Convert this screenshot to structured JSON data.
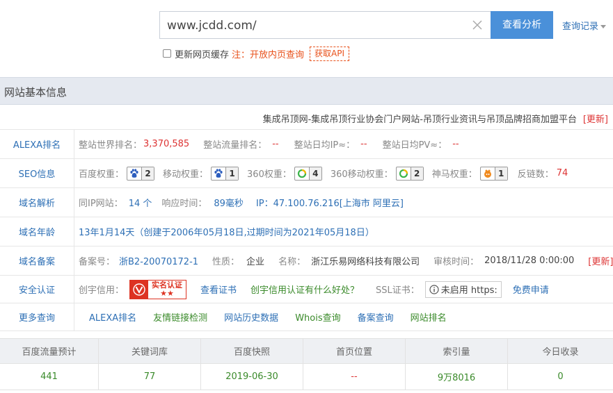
{
  "search": {
    "value": "www.jcdd.com/",
    "button_label": "查看分析",
    "history_label": "查询记录"
  },
  "options": {
    "cache_label": "更新网页缓存",
    "note": "注：开放内页查询",
    "api_label": "获取API"
  },
  "section": {
    "title": "网站基本信息",
    "site_title": "集成吊顶网-集成吊顶行业协会门户网站-吊顶行业资讯与吊顶品牌招商加盟平台",
    "update_label": "[更新]"
  },
  "alexa": {
    "label": "ALEXA排名",
    "world_rank_key": "整站世界排名：",
    "world_rank": "3,370,585",
    "traffic_rank_key": "整站流量排名：",
    "traffic_rank": "--",
    "daily_ip_key": "整站日均IP≈：",
    "daily_ip": "--",
    "daily_pv_key": "整站日均PV≈：",
    "daily_pv": "--"
  },
  "seo": {
    "label": "SEO信息",
    "baidu_key": "百度权重：",
    "baidu": "2",
    "mobile_key": "移动权重：",
    "mobile": "1",
    "s360_key": "360权重：",
    "s360": "4",
    "s360m_key": "360移动权重：",
    "s360m": "2",
    "shenma_key": "神马权重：",
    "shenma": "1",
    "backlinks_key": "反链数：",
    "backlinks": "74"
  },
  "dns": {
    "label": "域名解析",
    "same_ip_key": "同IP网站：",
    "same_ip": "14 个",
    "response_key": "响应时间：",
    "response": "89毫秒",
    "ip": "IP：47.100.76.216[上海市 阿里云]"
  },
  "age": {
    "label": "域名年龄",
    "value": "13年1月14天（创建于2006年05月18日,过期时间为2021年05月18日）"
  },
  "icp": {
    "label": "域名备案",
    "number_key": "备案号：",
    "number": "浙B2-20070172-1",
    "nature_key": "性质：",
    "nature": "企业",
    "name_key": "名称：",
    "name": "浙江乐易网络科技有限公司",
    "audit_key": "审核时间：",
    "audit": "2018/11/28 0:00:00",
    "update_label": "[更新]"
  },
  "security": {
    "label": "安全认证",
    "credit_key": "创宇信用：",
    "cert_badge": "实名认证",
    "cert_stars": "★★",
    "view_cert": "查看证书",
    "credit_link": "创宇信用认证有什么好处？",
    "ssl_key": "SSL证书：",
    "ssl_status": "未启用 https:",
    "free_apply": "免费申请"
  },
  "more": {
    "label": "更多查询",
    "links": [
      "ALEXA排名",
      "友情链接检测",
      "网站历史数据",
      "Whois查询",
      "备案查询",
      "网站排名"
    ]
  },
  "stats": {
    "headers": [
      "百度流量预计",
      "关键词库",
      "百度快照",
      "首页位置",
      "索引量",
      "今日收录"
    ],
    "values": [
      "441",
      "77",
      "2019-06-30",
      "--",
      "9万8016",
      "0"
    ]
  },
  "colors": {
    "accent": "#4a90d9",
    "link": "#2d6fb5",
    "red": "#d33333",
    "green": "#3a8a2a",
    "header_bg": "#e5e9f0"
  }
}
